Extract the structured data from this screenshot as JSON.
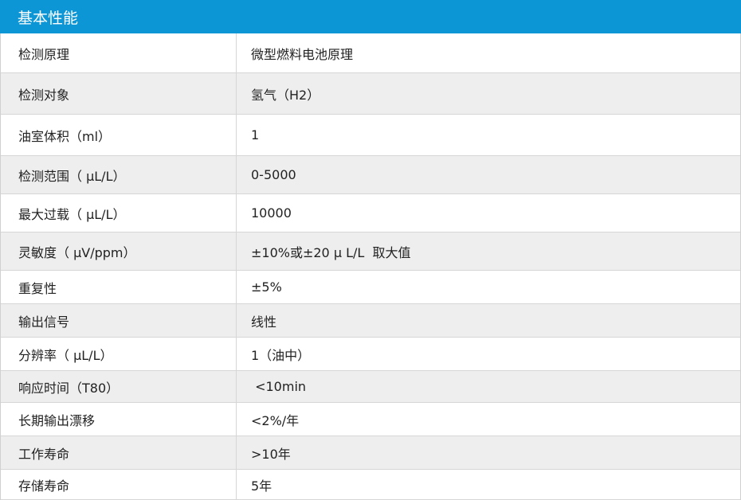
{
  "header": {
    "title": "基本性能"
  },
  "rows": [
    {
      "label": "检测原理",
      "value": "微型燃料电池原理",
      "height": 50
    },
    {
      "label": "检测对象",
      "value": "氢气（H2）",
      "height": 52
    },
    {
      "label": "油室体积（ml）",
      "value": "1",
      "height": 52
    },
    {
      "label": "检测范围（ μL/L）",
      "value": "0-5000",
      "height": 48
    },
    {
      "label": "最大过载（ μL/L）",
      "value": "10000",
      "height": 48
    },
    {
      "label": "灵敏度（ μV/ppm）",
      "value": "±10%或±20 μ L/L  取大值",
      "height": 48
    },
    {
      "label": "重复性",
      "value": "±5%",
      "height": 42
    },
    {
      "label": "输出信号",
      "value": "线性",
      "height": 42
    },
    {
      "label": "分辨率（ μL/L）",
      "value": "1（油中）",
      "height": 42
    },
    {
      "label": "响应时间（T80）",
      "value": " <10min",
      "height": 40
    },
    {
      "label": "长期输出漂移",
      "value": "<2%/年",
      "height": 42
    },
    {
      "label": "工作寿命",
      "value": ">10年",
      "height": 42
    },
    {
      "label": "存储寿命",
      "value": "5年",
      "height": 38
    }
  ]
}
